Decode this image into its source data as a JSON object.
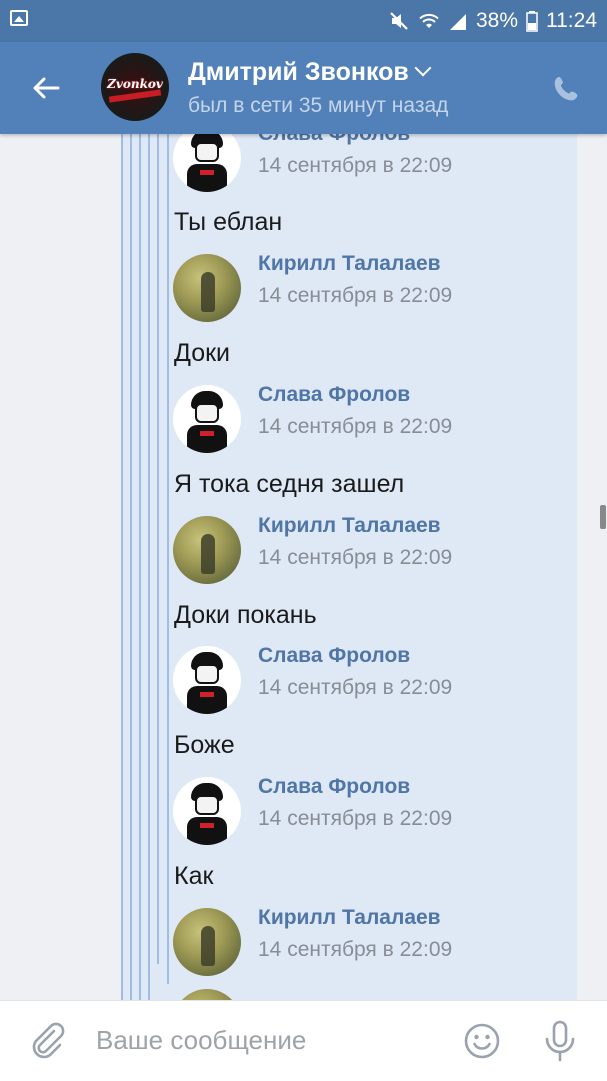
{
  "status_bar": {
    "battery": "38%",
    "time": "11:24",
    "icons": [
      "gallery-icon",
      "mute-icon",
      "wifi-icon",
      "signal-icon",
      "battery-icon"
    ]
  },
  "header": {
    "contact_name": "Дмитрий Звонков",
    "last_seen": "был в сети 35 минут назад",
    "avatar_logo_text": "Zvonkov",
    "colors": {
      "bar": "#5181b8",
      "status_bar": "#4a76a8"
    }
  },
  "messages": [
    {
      "author": "Слава Фролов",
      "avatar": "slava",
      "time": "14 сентября в 22:09",
      "text": "Ты еблан"
    },
    {
      "author": "Кирилл Талалаев",
      "avatar": "kirill",
      "time": "14 сентября в 22:09",
      "text": "Доки"
    },
    {
      "author": "Слава Фролов",
      "avatar": "slava",
      "time": "14 сентября в 22:09",
      "text": "Я тока седня зашел"
    },
    {
      "author": "Кирилл Талалаев",
      "avatar": "kirill",
      "time": "14 сентября в 22:09",
      "text": "Доки покань"
    },
    {
      "author": "Слава Фролов",
      "avatar": "slava",
      "time": "14 сентября в 22:09",
      "text": "Боже"
    },
    {
      "author": "Слава Фролов",
      "avatar": "slava",
      "time": "14 сентября в 22:09",
      "text": "Как"
    },
    {
      "author": "Кирилл Талалаев",
      "avatar": "kirill",
      "time": "14 сентября в 22:09",
      "text": ""
    }
  ],
  "composer": {
    "placeholder": "Ваше сообщение",
    "icons": [
      "attach-icon",
      "emoji-icon",
      "microphone-icon"
    ]
  }
}
